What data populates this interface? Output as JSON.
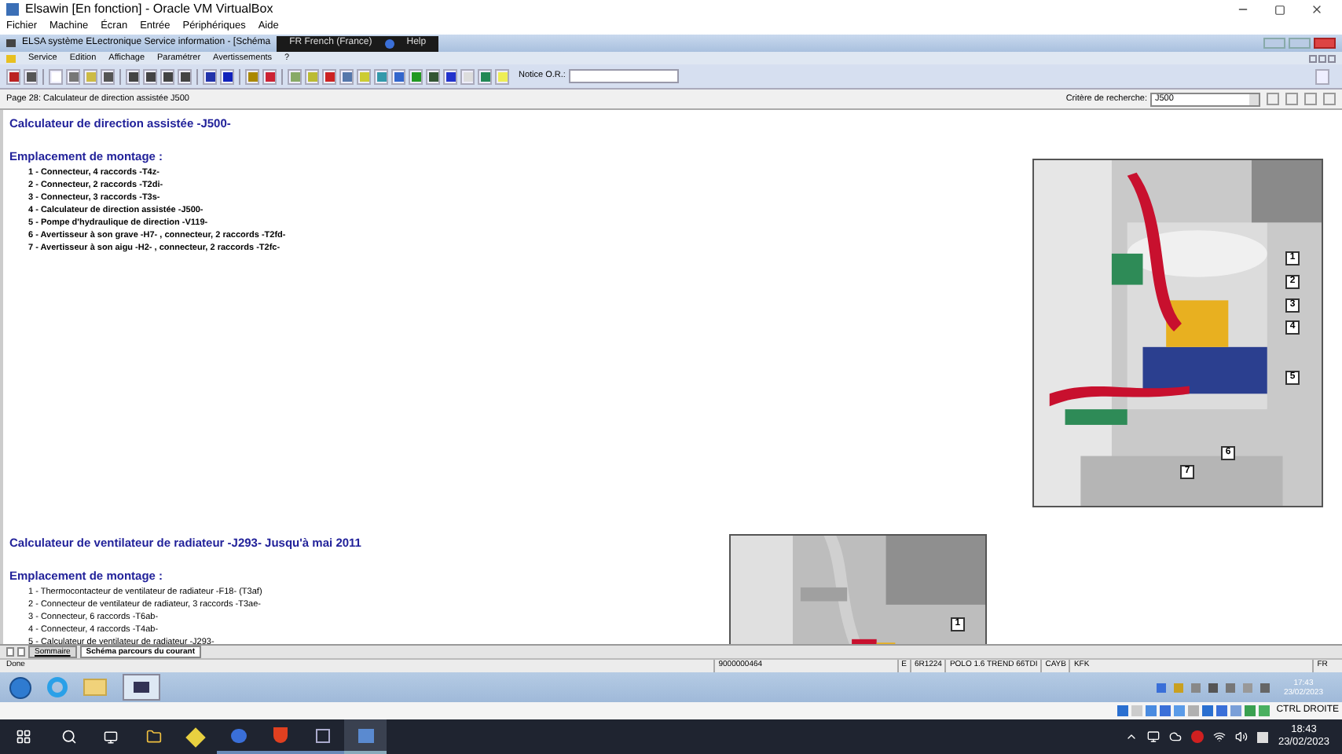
{
  "host_window": {
    "title": "Elsawin [En fonction] - Oracle VM VirtualBox",
    "menu": [
      "Fichier",
      "Machine",
      "Écran",
      "Entrée",
      "Périphériques",
      "Aide"
    ]
  },
  "app_window": {
    "title": "ELSA système ELectronique Service information - [Schéma",
    "language_popup": {
      "language": "FR French (France)",
      "help": "Help"
    },
    "menu": [
      "Service",
      "Edition",
      "Affichage",
      "Paramétrer",
      "Avertissements",
      "?"
    ]
  },
  "toolbar": {
    "notice_label": "Notice O.R.:"
  },
  "page_bar": {
    "page": "Page 28: Calculateur de direction assistée J500",
    "search_label": "Critère de recherche:",
    "search_value": "J500"
  },
  "sections": [
    {
      "title": "Calculateur de direction assistée -J500-",
      "subtitle": "Emplacement de montage :",
      "bold_items": true,
      "items": [
        "1 - Connecteur, 4 raccords -T4z-",
        "2 - Connecteur, 2 raccords -T2di-",
        "3 - Connecteur, 3 raccords -T3s-",
        "4 - Calculateur de direction assistée -J500-",
        "5 - Pompe d'hydraulique de direction -V119-",
        "6 - Avertisseur à son grave -H7- , connecteur, 2 raccords -T2fd-",
        "7 - Avertisseur à son aigu -H2- , connecteur, 2 raccords -T2fc-"
      ],
      "callouts": [
        "1",
        "2",
        "3",
        "4",
        "5",
        "6",
        "7"
      ]
    },
    {
      "title": "Calculateur de ventilateur de radiateur -J293- Jusqu'à mai 2011",
      "subtitle": "Emplacement de montage :",
      "bold_items": false,
      "items": [
        "1 - Thermocontacteur de ventilateur de radiateur -F18- (T3af)",
        "2 - Connecteur de ventilateur de radiateur, 3 raccords -T3ae-",
        "3 - Connecteur, 6 raccords -T6ab-",
        "4 - Connecteur, 4 raccords -T4ab-",
        "5 - Calculateur de ventilateur de radiateur -J293-"
      ],
      "callouts": [
        "1"
      ]
    }
  ],
  "sheet_tabs": [
    {
      "label": "Sommaire",
      "selected": false
    },
    {
      "label": "Schéma parcours du courant",
      "selected": true
    }
  ],
  "status_bar": {
    "status": "Done",
    "fields": [
      "9000000464",
      "E",
      "6R1224",
      "POLO 1.6 TREND 66TDI",
      "CAYB",
      "KFK",
      "FR"
    ]
  },
  "guest_taskbar": {
    "time": "17:43",
    "date": "23/02/2023"
  },
  "vbox_status": {
    "host_key": "CTRL DROITE"
  },
  "host_taskbar": {
    "time": "18:43",
    "date": "23/02/2023"
  }
}
